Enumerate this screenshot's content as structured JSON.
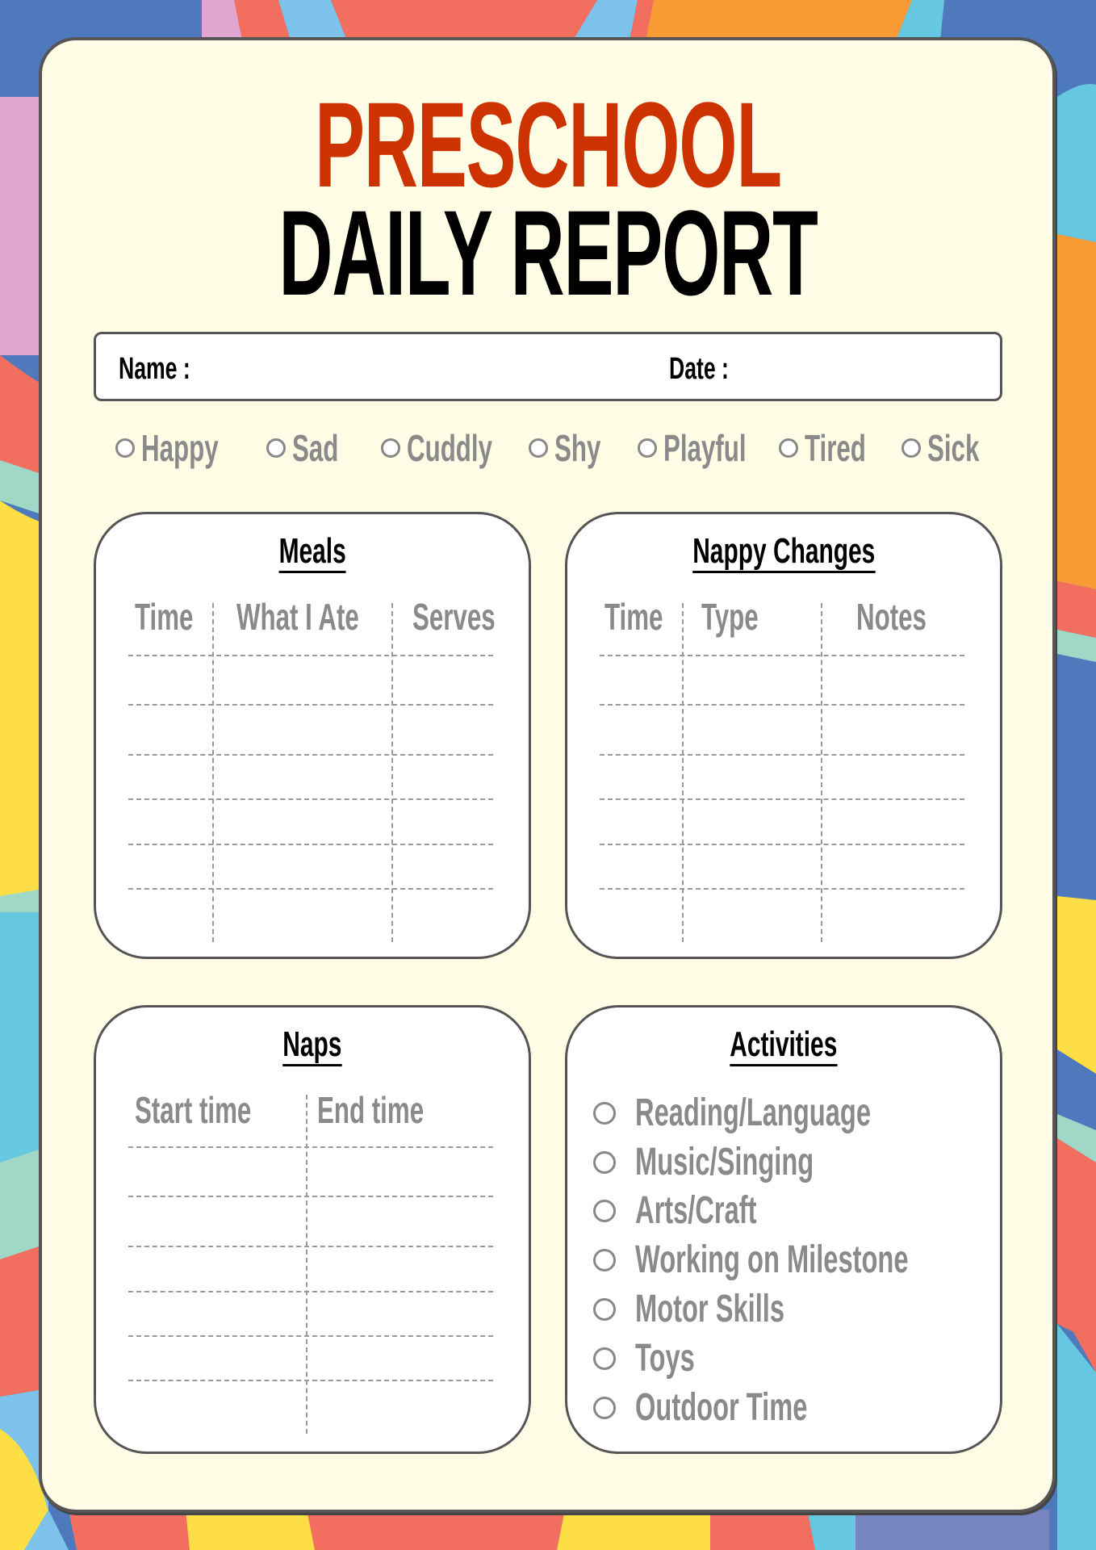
{
  "header": {
    "title_line1": "PRESCHOOL",
    "title_line2": "DAILY REPORT",
    "title_line1_color": "#cc3300",
    "title_line2_color": "#000000"
  },
  "info": {
    "name_label": "Name :",
    "date_label": "Date :",
    "name_value": "",
    "date_value": ""
  },
  "moods": [
    {
      "label": "Happy",
      "checked": false
    },
    {
      "label": "Sad",
      "checked": false
    },
    {
      "label": "Cuddly",
      "checked": false
    },
    {
      "label": "Shy",
      "checked": false
    },
    {
      "label": "Playful",
      "checked": false
    },
    {
      "label": "Tired",
      "checked": false
    },
    {
      "label": "Sick",
      "checked": false
    }
  ],
  "meals": {
    "title": "Meals",
    "columns": [
      "Time",
      "What I Ate",
      "Serves"
    ],
    "rows": [
      [
        "",
        "",
        ""
      ],
      [
        "",
        "",
        ""
      ],
      [
        "",
        "",
        ""
      ],
      [
        "",
        "",
        ""
      ],
      [
        "",
        "",
        ""
      ],
      [
        "",
        "",
        ""
      ]
    ]
  },
  "nappy": {
    "title": "Nappy Changes",
    "columns": [
      "Time",
      "Type",
      "Notes"
    ],
    "rows": [
      [
        "",
        "",
        ""
      ],
      [
        "",
        "",
        ""
      ],
      [
        "",
        "",
        ""
      ],
      [
        "",
        "",
        ""
      ],
      [
        "",
        "",
        ""
      ],
      [
        "",
        "",
        ""
      ]
    ]
  },
  "naps": {
    "title": "Naps",
    "columns": [
      "Start time",
      "End time"
    ],
    "rows": [
      [
        "",
        ""
      ],
      [
        "",
        ""
      ],
      [
        "",
        ""
      ],
      [
        "",
        ""
      ],
      [
        "",
        ""
      ],
      [
        "",
        ""
      ]
    ]
  },
  "activities": {
    "title": "Activities",
    "items": [
      {
        "label": "Reading/Language",
        "checked": false
      },
      {
        "label": "Music/Singing",
        "checked": false
      },
      {
        "label": "Arts/Craft",
        "checked": false
      },
      {
        "label": "Working on Milestone",
        "checked": false
      },
      {
        "label": "Motor Skills",
        "checked": false
      },
      {
        "label": "Toys",
        "checked": false
      },
      {
        "label": "Outdoor Time",
        "checked": false
      }
    ]
  }
}
